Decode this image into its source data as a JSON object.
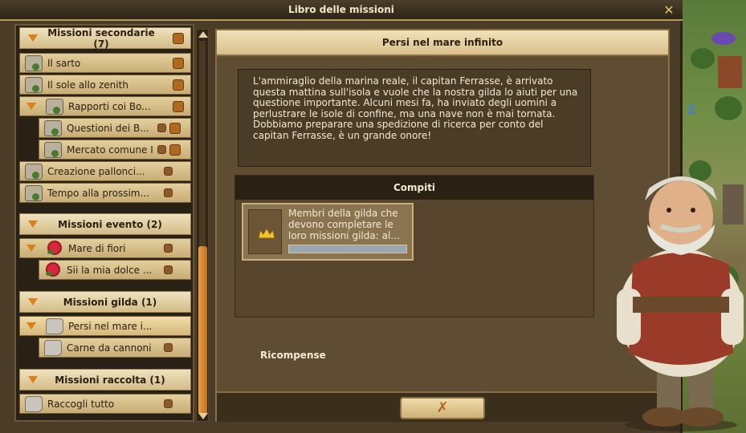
{
  "window": {
    "title": "Libro delle missioni",
    "close_icon": "close-icon"
  },
  "sidebar": {
    "groups": [
      {
        "label": "Missioni secondarie (7)",
        "items": [
          {
            "label": "Il sarto",
            "icon": "scroll-icon"
          },
          {
            "label": "Il sole allo zenith",
            "icon": "scroll-icon"
          },
          {
            "label": "Rapporti coi Bo...",
            "icon": "scroll-icon",
            "expanded": true
          },
          {
            "label": "Questioni dei B...",
            "icon": "scroll-icon"
          },
          {
            "label": "Mercato comune I",
            "icon": "scroll-icon"
          },
          {
            "label": "Creazione palloncі...",
            "icon": "scroll-icon"
          },
          {
            "label": "Tempo alla prossim...",
            "icon": "scroll-icon"
          }
        ]
      },
      {
        "label": "Missioni evento (2)",
        "items": [
          {
            "label": "Mare di fiori",
            "icon": "rose-icon"
          },
          {
            "label": "Sii la mia dolce ...",
            "icon": "rose-icon"
          }
        ]
      },
      {
        "label": "Missioni gilda (1)",
        "items": [
          {
            "label": "Persi nel mare i...",
            "icon": "boot-icon",
            "selected": true
          },
          {
            "label": "Carne da cannoni",
            "icon": "boot-icon"
          }
        ]
      },
      {
        "label": "Missioni raccolta (1)",
        "items": [
          {
            "label": "Raccogli tutto",
            "icon": "boot-icon"
          }
        ]
      }
    ]
  },
  "quest": {
    "title": "Persi nel mare infinito",
    "description": "L'ammiraglio della marina reale, il capitan Ferrasse, è arrivato questa mattina sull'isola e vuole che la nostra gilda lo aiuti per una questione importante. Alcuni mesi fa, ha inviato degli uomini a perlustrare le isole di confine, ma una nave non è mai tornata. Dobbiamo preparare una spedizione di ricerca per conto del capitan Ferrasse, è un grande onore!",
    "tasks_label": "Compiti",
    "task": {
      "text": "Membri della gilda che devono completare le loro missioni gilda: al...",
      "icon": "crown-icon",
      "progress": 0.0
    },
    "rewards_label": "Ricompense",
    "close_button": "✗"
  }
}
